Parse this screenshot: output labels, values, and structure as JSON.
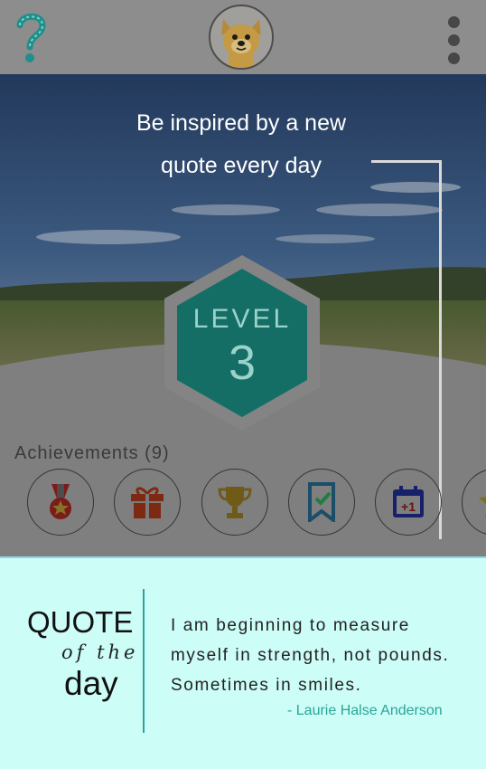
{
  "header": {
    "help_icon": "question-mark-icon",
    "avatar_icon": "dog-avatar-icon",
    "menu_icon": "kebab-menu-icon"
  },
  "hero": {
    "tip_line_1": "Be inspired by a new",
    "tip_line_2": "quote every day",
    "level_label": "LEVEL",
    "level_number": "3"
  },
  "achievements": {
    "title": "Achievements (9)",
    "items": [
      {
        "icon": "medal-icon"
      },
      {
        "icon": "gift-icon"
      },
      {
        "icon": "trophy-icon"
      },
      {
        "icon": "bookmark-check-icon"
      },
      {
        "icon": "calendar-plus-one-icon",
        "text": "+1"
      },
      {
        "icon": "star-icon"
      }
    ]
  },
  "quote": {
    "heading_1": "QUOTE",
    "heading_2": "of the",
    "heading_3": "day",
    "line_1": "I am beginning to measure",
    "line_2": "myself in strength, not pounds.",
    "line_3": "Sometimes in smiles.",
    "author": "- Laurie Halse Anderson"
  },
  "colors": {
    "overlay": "#7f7f7f",
    "teal": "#2aa598",
    "quote_bg": "#ccfdf7"
  }
}
